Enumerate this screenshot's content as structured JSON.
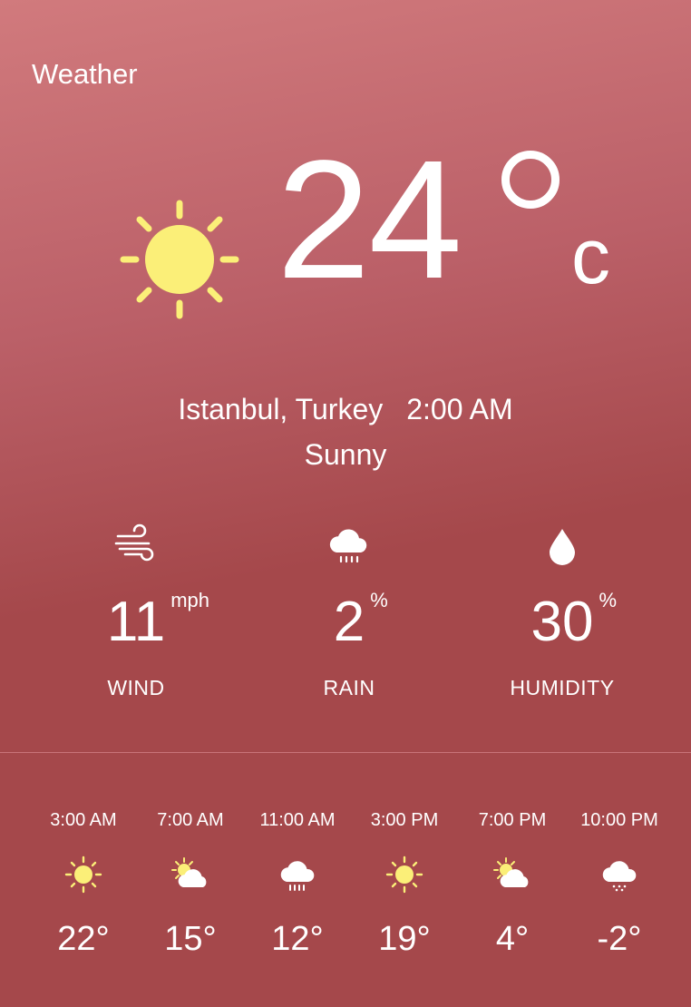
{
  "app": {
    "title": "Weather"
  },
  "current": {
    "temperature": "24",
    "unit": "c",
    "location": "Istanbul, Turkey",
    "time": "2:00 AM",
    "condition": "Sunny",
    "icon": "sun-icon"
  },
  "stats": [
    {
      "icon": "wind-icon",
      "value": "11",
      "unit": "mph",
      "label": "WIND"
    },
    {
      "icon": "rain-cloud-icon",
      "value": "2",
      "unit": "%",
      "label": "RAIN"
    },
    {
      "icon": "droplet-icon",
      "value": "30",
      "unit": "%",
      "label": "HUMIDITY"
    }
  ],
  "forecast": [
    {
      "time": "3:00 AM",
      "icon": "sun-icon",
      "temp": "22°"
    },
    {
      "time": "7:00 AM",
      "icon": "partly-cloudy-icon",
      "temp": "15°"
    },
    {
      "time": "11:00 AM",
      "icon": "rain-cloud-icon",
      "temp": "12°"
    },
    {
      "time": "3:00 PM",
      "icon": "sun-icon",
      "temp": "19°"
    },
    {
      "time": "7:00 PM",
      "icon": "partly-cloudy-icon",
      "temp": "4°"
    },
    {
      "time": "10:00 PM",
      "icon": "snow-cloud-icon",
      "temp": "-2°"
    }
  ],
  "colors": {
    "sun": "#fbef78",
    "background": "#a5484b",
    "text": "#ffffff"
  }
}
